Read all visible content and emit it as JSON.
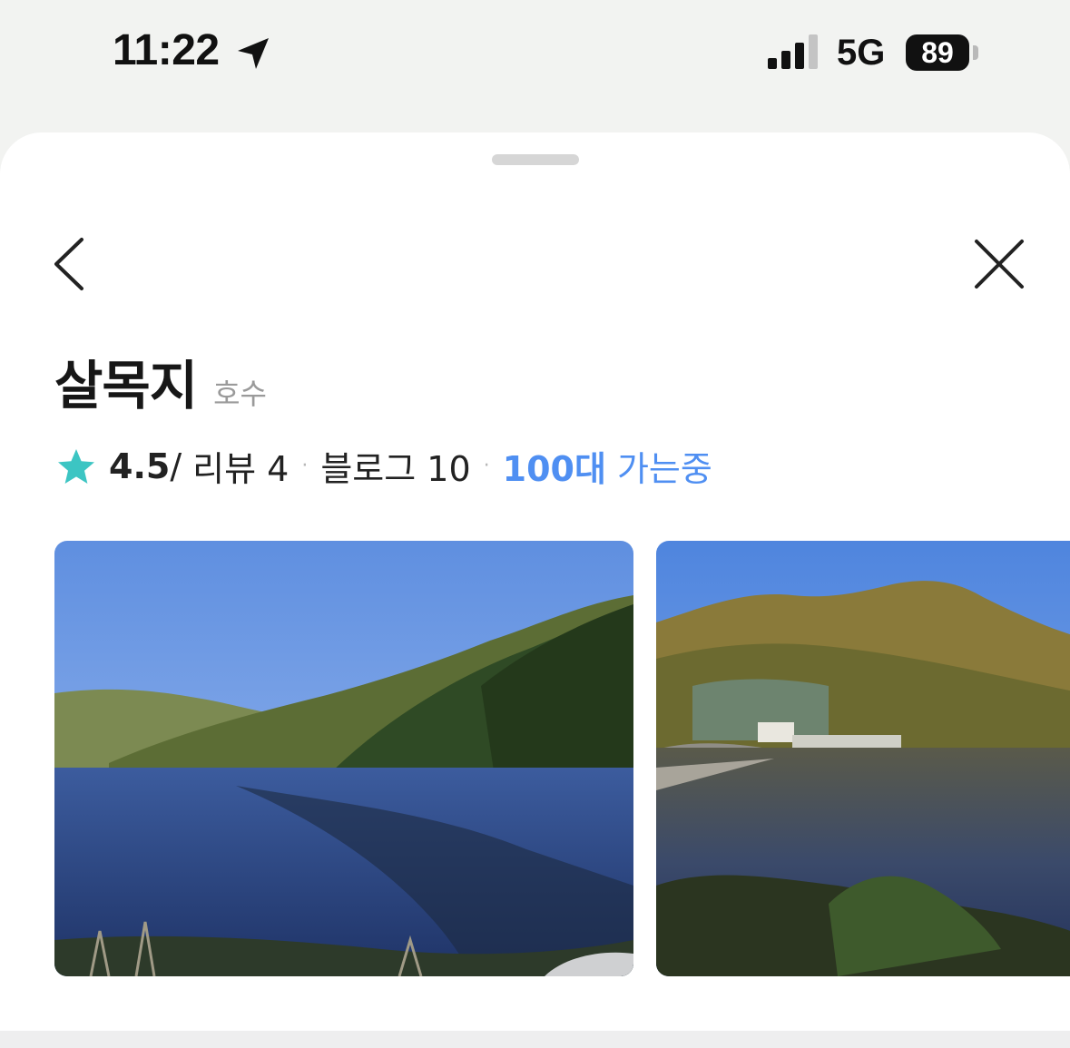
{
  "status_bar": {
    "time": "11:22",
    "network": "5G",
    "battery": "89",
    "icons": [
      "location-arrow-icon",
      "cellular-signal-icon",
      "battery-icon"
    ]
  },
  "header": {
    "back_icon": "chevron-left-icon",
    "close_icon": "close-icon"
  },
  "place": {
    "name": "살목지",
    "category": "호수",
    "rating": "4.5",
    "rating_suffix": "/",
    "reviews": "리뷰 4",
    "blogs": "블로그 10",
    "driving_count": "100대",
    "driving_text": "가는중"
  },
  "photos": [
    {
      "subject": "lake-with-forested-hills"
    },
    {
      "subject": "lake-with-dam-and-autumn-hill"
    }
  ],
  "colors": {
    "accent_blue": "#4f8ff2",
    "star_teal": "#3cc5c3",
    "background": "#f2f3f1"
  }
}
